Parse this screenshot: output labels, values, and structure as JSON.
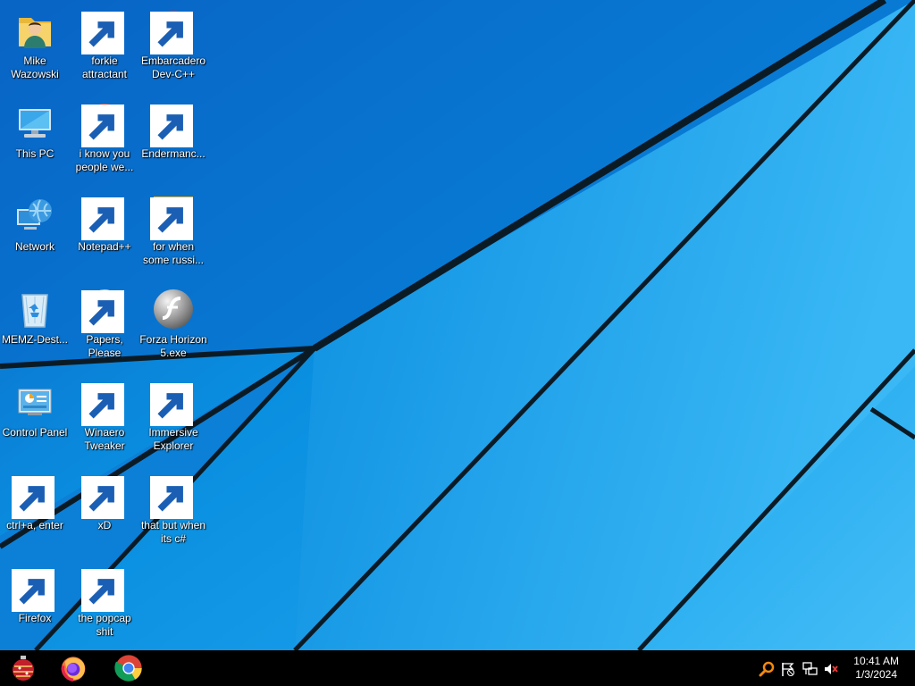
{
  "desktop_icons": [
    {
      "label": "Mike\nWazowski",
      "icon": "user-folder-icon",
      "shortcut": false
    },
    {
      "label": "forkie\nattractant",
      "icon": "settings-monitor-icon",
      "shortcut": true
    },
    {
      "label": "Embarcadero\nDev-C++",
      "icon": "devcpp-icon",
      "shortcut": true
    },
    {
      "label": "This PC",
      "icon": "computer-icon",
      "shortcut": false
    },
    {
      "label": "i know you\npeople we...",
      "icon": "chrome-icon",
      "shortcut": true
    },
    {
      "label": "Endermanc...",
      "icon": "window-app-icon",
      "shortcut": true
    },
    {
      "label": "Network",
      "icon": "network-icon",
      "shortcut": false
    },
    {
      "label": "Notepad++",
      "icon": "notepadpp-icon",
      "shortcut": true
    },
    {
      "label": "for when\nsome russi...",
      "icon": "detect-it-easy-icon",
      "shortcut": true
    },
    {
      "label": "MEMZ-Dest...",
      "icon": "recycle-bin-icon",
      "shortcut": false
    },
    {
      "label": "Papers, Please",
      "icon": "papers-please-icon",
      "shortcut": true
    },
    {
      "label": "Forza Horizon\n5.exe",
      "icon": "flash-icon",
      "shortcut": false
    },
    {
      "label": "Control Panel",
      "icon": "control-panel-icon",
      "shortcut": false
    },
    {
      "label": "Winaero\nTweaker",
      "icon": "winaero-icon",
      "shortcut": true
    },
    {
      "label": "Immersive\nExplorer",
      "icon": "immersive-monitor-icon",
      "shortcut": true
    },
    {
      "label": "ctrl+a, enter",
      "icon": "magnifier-icon",
      "shortcut": true
    },
    {
      "label": "xD",
      "icon": "hxd-icon",
      "shortcut": true
    },
    {
      "label": "that but when\nits c#",
      "icon": "stacked-windows-icon",
      "shortcut": true
    },
    {
      "label": "Firefox",
      "icon": "firefox-icon",
      "shortcut": true
    },
    {
      "label": "the popcap\nshit",
      "icon": "popcap-folder-icon",
      "shortcut": true
    }
  ],
  "taskbar": {
    "start_icon": "ornament-start-icon",
    "pinned": [
      {
        "name": "Firefox",
        "icon": "firefox-icon"
      },
      {
        "name": "Google Chrome",
        "icon": "chrome-icon"
      }
    ],
    "tray_icons": [
      "magnifier-icon",
      "action-center-flag-icon",
      "network-icon",
      "volume-muted-icon"
    ],
    "clock": {
      "time": "10:41 AM",
      "date": "1/3/2024"
    }
  },
  "colors": {
    "wallpaper": "#0a9be8",
    "wallpaper_light": "#3fb8f5",
    "wallpaper_dark": "#0569c4",
    "taskbar": "#000000",
    "text": "#ffffff"
  }
}
